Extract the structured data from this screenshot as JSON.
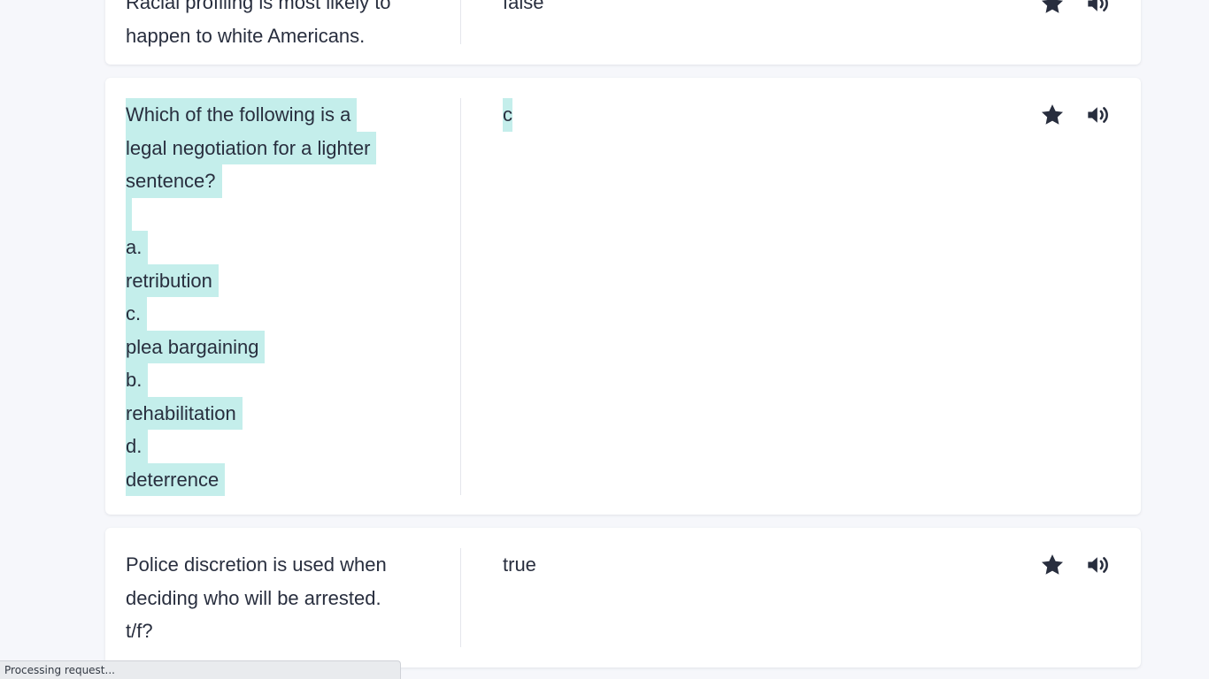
{
  "cards": [
    {
      "term_lines": [
        "Racial profiling is most likely to",
        "happen to white Americans."
      ],
      "definition": "false"
    },
    {
      "term_lines": [
        "Which of the following is a",
        "legal negotiation for a lighter",
        "sentence?",
        "",
        "a.",
        "retribution",
        "c.",
        "plea bargaining",
        "b.",
        "rehabilitation",
        "d.",
        "deterrence"
      ],
      "definition": "c"
    },
    {
      "term_lines": [
        "Police discretion is used when",
        "deciding who will be arrested.",
        "t/f?"
      ],
      "definition": "true"
    }
  ],
  "icons": {
    "star": "star-icon",
    "audio": "speaker-icon"
  },
  "status_bar": {
    "text": "Processing request..."
  },
  "colors": {
    "highlight": "#c4eeeb",
    "text": "#282e3e",
    "background": "#f6f7fb"
  }
}
